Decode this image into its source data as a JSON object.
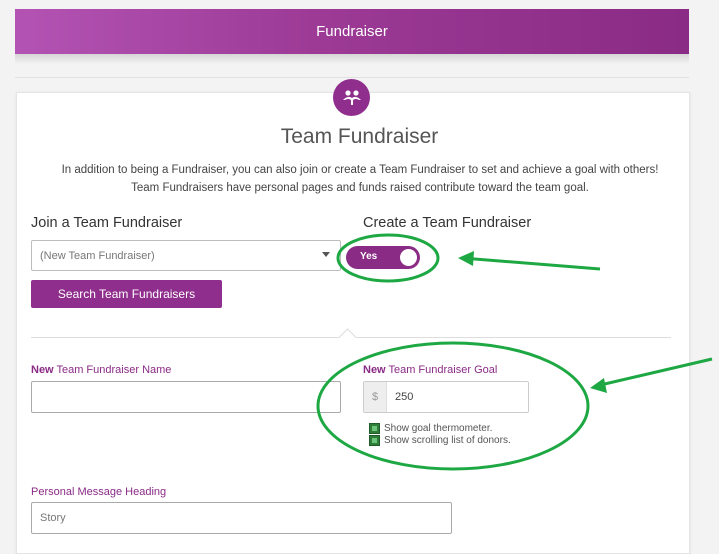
{
  "header": {
    "title": "Fundraiser"
  },
  "page": {
    "title": "Team Fundraiser",
    "description_line1": "In addition to being a Fundraiser, you can also join or create a Team Fundraiser to set and achieve a goal with others!",
    "description_line2": "Team Fundraisers have personal pages and funds raised contribute toward the team goal.",
    "icon": "team-people-icon"
  },
  "join": {
    "heading": "Join a Team Fundraiser",
    "select_value": "(New Team Fundraiser)",
    "search_button": "Search Team Fundraisers"
  },
  "create": {
    "heading": "Create a Team Fundraiser",
    "toggle_label": "Yes",
    "toggle_on": true
  },
  "form": {
    "name_label_prefix": "New",
    "name_label_rest": " Team Fundraiser Name",
    "name_value": "",
    "goal_label_prefix": "New",
    "goal_label_rest": " Team Fundraiser Goal",
    "goal_currency": "$",
    "goal_value": "250",
    "show_thermometer": "Show goal thermometer.",
    "show_donors": "Show scrolling list of donors.",
    "personal_heading_label": "Personal Message Heading",
    "personal_heading_value": "Story"
  },
  "colors": {
    "brand": "#8f2e8c",
    "annotation": "#1ea843"
  }
}
